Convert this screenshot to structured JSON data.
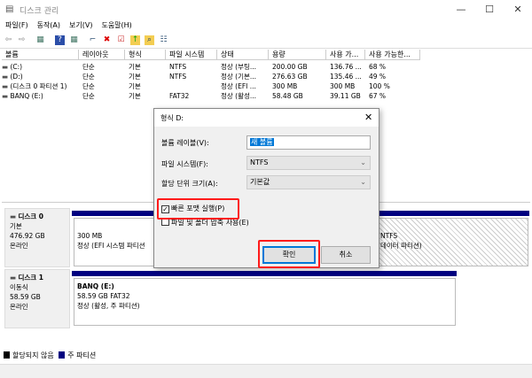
{
  "window": {
    "title": "디스크 관리"
  },
  "menu": [
    "파일(F)",
    "동작(A)",
    "보기(V)",
    "도움말(H)"
  ],
  "toolbar": {
    "icons": [
      "back-icon",
      "forward-icon",
      "console-tree-icon",
      "help-icon",
      "properties-icon",
      "connect-icon",
      "delete-icon",
      "check-icon",
      "folder-up-icon",
      "search-folder-icon",
      "list-icon"
    ]
  },
  "table": {
    "headers": [
      "볼륨",
      "레이아웃",
      "형식",
      "파일 시스템",
      "상태",
      "용량",
      "사용 가...",
      "사용 가능한..."
    ],
    "rows": [
      [
        "(C:)",
        "단순",
        "기본",
        "NTFS",
        "정상 (부팅...",
        "200.00 GB",
        "136.76 ...",
        "68 %"
      ],
      [
        "(D:)",
        "단순",
        "기본",
        "NTFS",
        "정상 (기본...",
        "276.63 GB",
        "135.46 ...",
        "49 %"
      ],
      [
        "(디스크 0 파티션 1)",
        "단순",
        "기본",
        "",
        "정상 (EFI ...",
        "300 MB",
        "300 MB",
        "100 %"
      ],
      [
        "BANQ (E:)",
        "단순",
        "기본",
        "FAT32",
        "정상 (활성...",
        "58.48 GB",
        "39.11 GB",
        "67 %"
      ]
    ]
  },
  "disks": [
    {
      "name": "디스크 0",
      "type": "기본",
      "size": "476.92 GB",
      "status": "온라인",
      "parts": [
        {
          "line1": "300 MB",
          "line2": "정상 (EFI 시스템 파티션"
        },
        {
          "line1": "NTFS",
          "line2": "데이터 파티션)"
        }
      ]
    },
    {
      "name": "디스크 1",
      "type": "이동식",
      "size": "58.59 GB",
      "status": "온라인",
      "parts": [
        {
          "title": "BANQ  (E:)",
          "line1": "58.59 GB FAT32",
          "line2": "정상 (활성, 주 파티션)"
        }
      ]
    }
  ],
  "legend": [
    {
      "label": "할당되지 않음",
      "color": "#000000"
    },
    {
      "label": "주 파티션",
      "color": "#000080"
    }
  ],
  "dialog": {
    "title": "형식 D:",
    "volume_label": "볼륨 레이블(V):",
    "volume_value": "새 볼륨",
    "fs_label": "파일 시스템(F):",
    "fs_value": "NTFS",
    "alloc_label": "할당 단위 크기(A):",
    "alloc_value": "기본값",
    "quick_format": "빠른 포맷 실행(P)",
    "quick_checked": true,
    "compress": "파일 및 폴더 압축 사용(E)",
    "compress_checked": false,
    "ok": "확인",
    "cancel": "취소"
  },
  "highlight_color": "#ff1a1a"
}
